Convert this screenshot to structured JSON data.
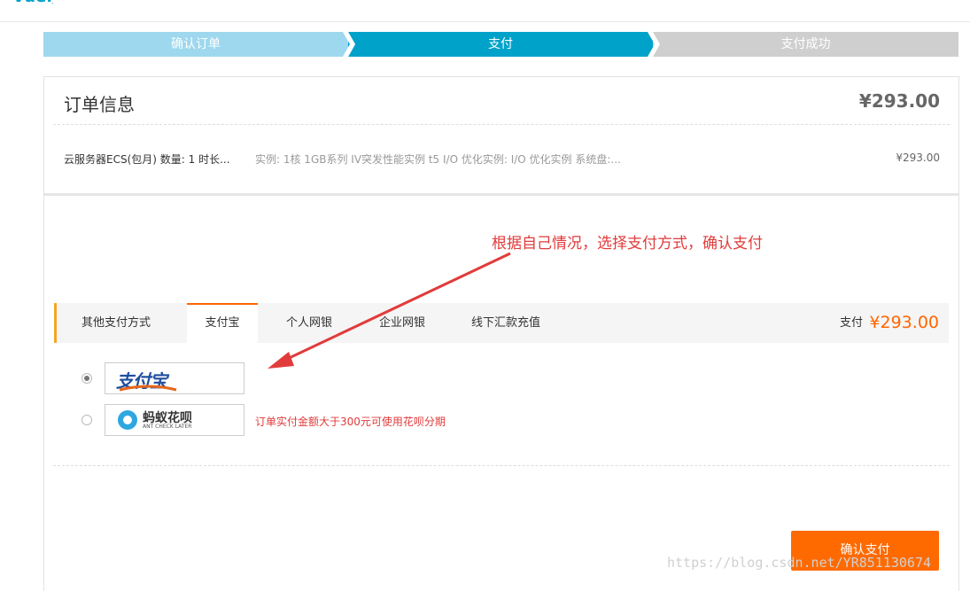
{
  "steps": [
    "确认订单",
    "支付",
    "支付成功"
  ],
  "order": {
    "title": "订单信息",
    "total": "¥293.00",
    "item_name": "云服务器ECS(包月) 数量: 1 时长...",
    "item_spec": "实例: 1核 1GB系列 IV突发性能实例 t5 I/O 优化实例: I/O 优化实例 系统盘:...",
    "item_price": "¥293.00"
  },
  "annotation": "根据自己情况，选择支付方式，确认支付",
  "tabs": [
    "其他支付方式",
    "支付宝",
    "个人网银",
    "企业网银",
    "线下汇款充值"
  ],
  "active_tab": "支付宝",
  "pay": {
    "label": "支付",
    "amount": "¥293.00"
  },
  "options": [
    {
      "name": "支付宝",
      "selected": true
    },
    {
      "name": "蚂蚁花呗",
      "sub": "ANT CHECK LATER",
      "selected": false,
      "hint": "订单实付金额大于300元可使用花呗分期"
    }
  ],
  "confirm_label": "确认支付",
  "watermark": "https://blog.csdn.net/YR851130674",
  "colors": {
    "accent": "#ff6a00",
    "step_active": "#00a2ca",
    "step_done": "#9ed8ee",
    "step_pending": "#cfcfcf",
    "annotation": "#e23b3b"
  }
}
